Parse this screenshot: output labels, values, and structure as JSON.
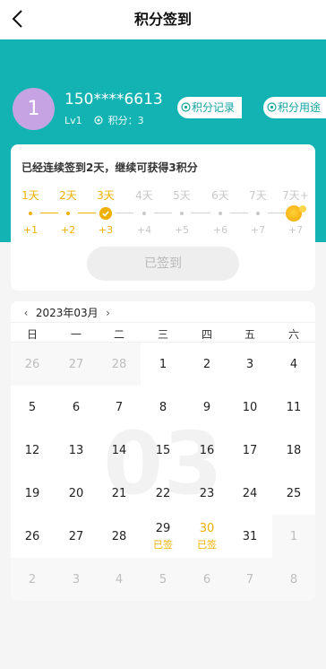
{
  "nav": {
    "title": "积分签到"
  },
  "user": {
    "avatar": "1",
    "phone": "150****6613",
    "level": "Lv1",
    "points_text": "积分：3"
  },
  "links": {
    "record": "积分记录",
    "usage": "积分用途"
  },
  "signin": {
    "tip": "已经连续签到2天，继续可获得3积分",
    "days": [
      "1天",
      "2天",
      "3天",
      "4天",
      "5天",
      "6天",
      "7天",
      "7天+"
    ],
    "points": [
      "+1",
      "+2",
      "+3",
      "+4",
      "+5",
      "+6",
      "+7",
      "+7"
    ],
    "button": "已签到"
  },
  "calendar": {
    "prev": "‹",
    "next": "›",
    "month": "2023年03月",
    "watermark": "03",
    "weekdays": [
      "日",
      "一",
      "二",
      "三",
      "四",
      "五",
      "六"
    ],
    "rows": [
      [
        "26",
        "27",
        "28",
        "1",
        "2",
        "3",
        "4"
      ],
      [
        "5",
        "6",
        "7",
        "8",
        "9",
        "10",
        "11"
      ],
      [
        "12",
        "13",
        "14",
        "15",
        "16",
        "17",
        "18"
      ],
      [
        "19",
        "20",
        "21",
        "22",
        "23",
        "24",
        "25"
      ],
      [
        "26",
        "27",
        "28",
        "29",
        "30",
        "31",
        "1"
      ],
      [
        "2",
        "3",
        "4",
        "5",
        "6",
        "7",
        "8"
      ]
    ],
    "signed_label": "已签"
  },
  "colors": {
    "accent": "#14b3b3",
    "gold": "#f0b000",
    "avatar": "#c6a4e4"
  },
  "icons": {
    "back": "back-arrow-icon",
    "coin": "coin-icon",
    "link": "coin-icon",
    "check": "check-icon",
    "gift": "gift-icon"
  }
}
